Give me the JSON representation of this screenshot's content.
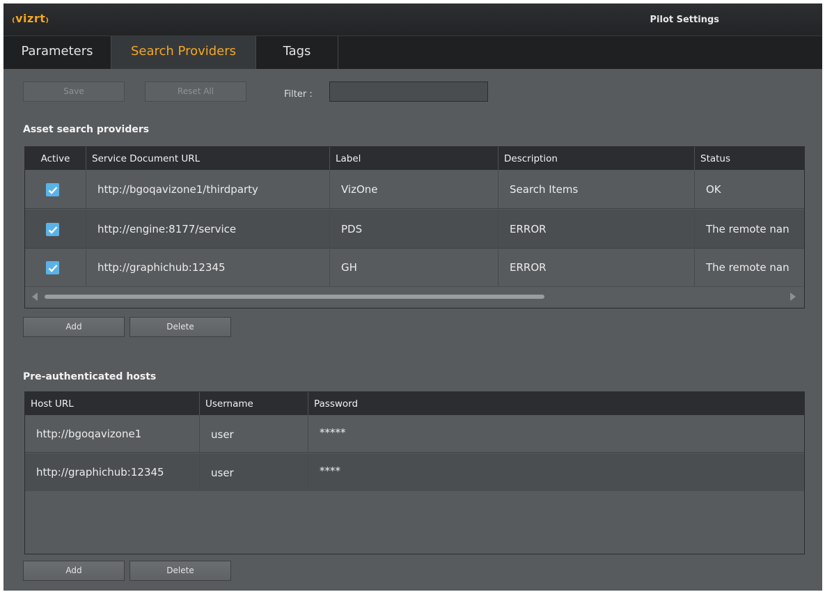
{
  "app": {
    "logo": "₍vizrt₎",
    "title": "Pilot Settings"
  },
  "tabs": [
    {
      "label": "Parameters"
    },
    {
      "label": "Search Providers",
      "active": true
    },
    {
      "label": "Tags"
    }
  ],
  "toolbar": {
    "save_label": "Save",
    "reset_label": "Reset All",
    "filter_label": "Filter :",
    "filter_value": ""
  },
  "providers": {
    "title": "Asset search providers",
    "columns": [
      "Active",
      "Service Document URL",
      "Label",
      "Description",
      "Status"
    ],
    "rows": [
      {
        "active": true,
        "url": "http://bgoqavizone1/thirdparty",
        "label": "VizOne",
        "description": "Search Items",
        "status": "OK"
      },
      {
        "active": true,
        "url": "http://engine:8177/service",
        "label": "PDS",
        "description": "ERROR",
        "status": "The remote nan"
      },
      {
        "active": true,
        "url": "http://graphichub:12345",
        "label": "GH",
        "description": "ERROR",
        "status": "The remote nan"
      }
    ],
    "add_label": "Add",
    "delete_label": "Delete"
  },
  "hosts": {
    "title": "Pre-authenticated hosts",
    "columns": [
      "Host URL",
      "Username",
      "Password"
    ],
    "rows": [
      {
        "host": "http://bgoqavizone1",
        "username": "user",
        "password": "*****"
      },
      {
        "host": "http://graphichub:12345",
        "username": "user",
        "password": "****"
      }
    ],
    "add_label": "Add",
    "delete_label": "Delete"
  },
  "colors": {
    "accent": "#f5a623",
    "checkbox": "#5ab3e8"
  }
}
